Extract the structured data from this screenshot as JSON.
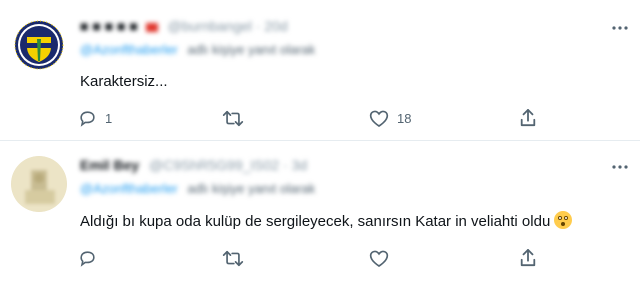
{
  "tweets": [
    {
      "display_name": "■ ■ ■ ■ ■",
      "handle": "@burnbangel · 20d",
      "reply_mention": "@Azonfthaberler",
      "reply_suffix": "adlı kişiye yanıt olarak",
      "text": "Karaktersiz...",
      "actions": {
        "reply_count": "1",
        "retweet_count": "",
        "like_count": "18"
      }
    },
    {
      "display_name": "Emil Bey",
      "handle": "@C9ShR5G99_IS02 · 3d",
      "reply_mention": "@Azonfthaberler",
      "reply_suffix": "adlı kişiye yanıt olarak",
      "text": "Aldığı bı kupa oda kulüp de sergileyecek, sanırsın Katar in veliahti oldu",
      "actions": {
        "reply_count": "",
        "retweet_count": "",
        "like_count": ""
      }
    }
  ],
  "icons": {
    "reply": "reply-icon",
    "retweet": "retweet-icon",
    "like": "like-icon",
    "share": "share-icon",
    "more": "more-icon",
    "emoji": "flushed-face-emoji"
  },
  "colors": {
    "text": "#0f1419",
    "secondary": "#536471",
    "link": "#1d9bf0",
    "divider": "#e6ecf0",
    "club_navy": "#1a2a6c",
    "club_yellow": "#f5d100"
  }
}
